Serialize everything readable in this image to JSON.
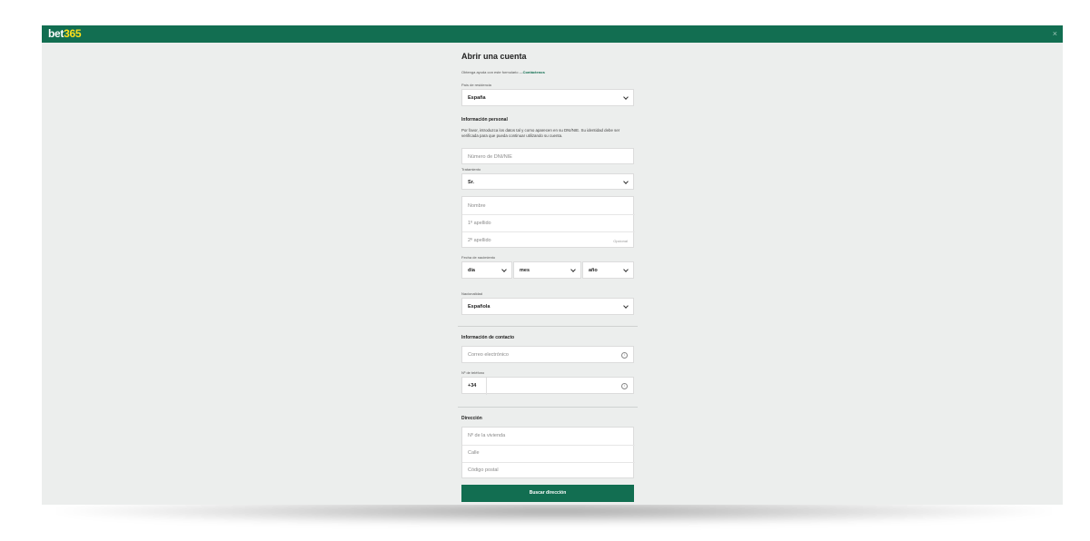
{
  "app": {
    "logo_main": "bet",
    "logo_num": "365",
    "close": "×"
  },
  "form": {
    "title": "Abrir una cuenta",
    "help_text": "Obtenga ayuda con este formulario —",
    "help_link": "Contáctenos",
    "country": {
      "label": "País de residencia",
      "value": "España"
    },
    "personal": {
      "heading": "Información personal",
      "description": "Por favor, introduzca los datos tal y como aparecen en su DNI/NIE. Su identidad debe ser verificada para que pueda continuar utilizando su cuenta.",
      "id_placeholder": "Número de DNI/NIE",
      "title_label": "Tratamiento",
      "title_value": "Sr.",
      "name_placeholder": "Nombre",
      "surname1_placeholder": "1º apellido",
      "surname2_placeholder": "2º apellido",
      "optional": "Opcional",
      "dob_label": "Fecha de nacimiento",
      "dob_day": "día",
      "dob_month": "mes",
      "dob_year": "año",
      "nationality_label": "Nacionalidad",
      "nationality_value": "Española"
    },
    "contact": {
      "heading": "Información de contacto",
      "email_placeholder": "Correo electrónico",
      "phone_label": "Nº de teléfono",
      "phone_prefix": "+34"
    },
    "address": {
      "heading": "Dirección",
      "number_placeholder": "Nº de la vivienda",
      "street_placeholder": "Calle",
      "postcode_placeholder": "Código postal",
      "search_button": "Buscar dirección"
    }
  }
}
